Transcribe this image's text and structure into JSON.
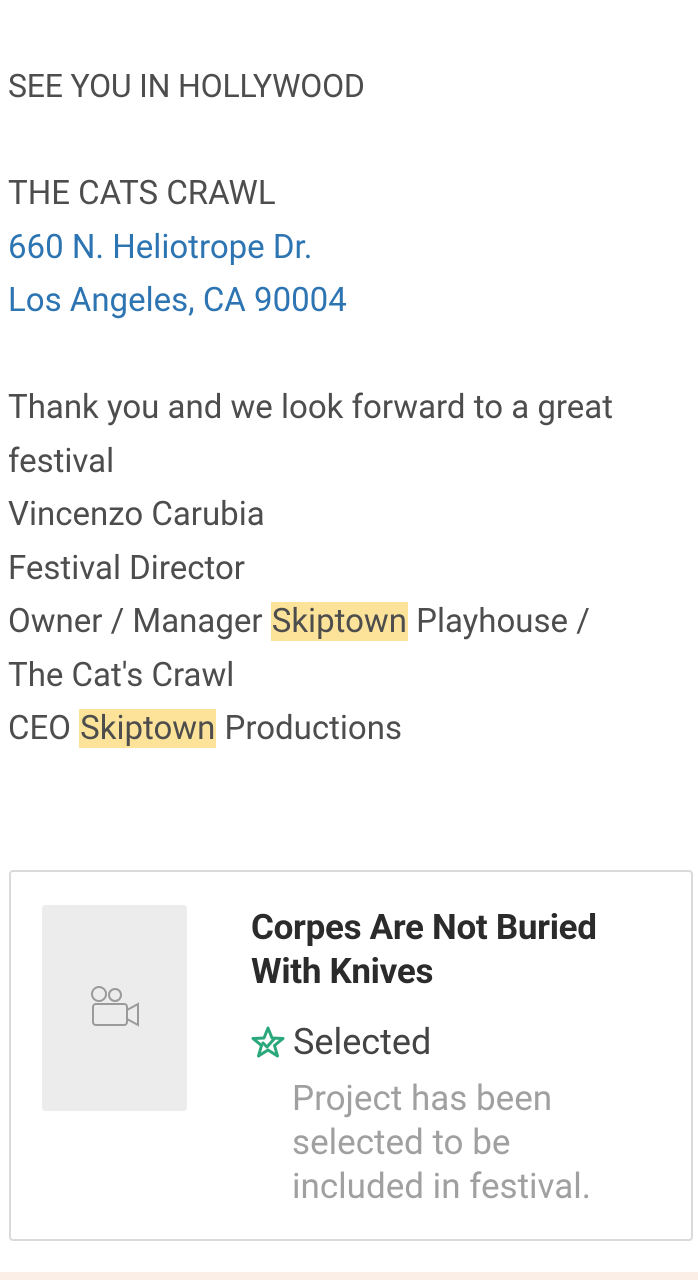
{
  "message": {
    "heading": "SEE YOU IN HOLLYWOOD",
    "venue_name": "THE CATS CRAWL",
    "address_line1": "660 N. Heliotrope Dr.",
    "address_line2": "Los Angeles, CA 90004",
    "thanks_line1": "Thank you and we look forward to a great",
    "thanks_line2": "festival",
    "signer_name": "Vincenzo Carubia",
    "signer_title": "Festival Director",
    "owner_prefix": "Owner / Manager ",
    "highlight_term": "Skiptown",
    "owner_suffix": " Playhouse /",
    "owner_line2": "The Cat's Crawl",
    "ceo_prefix": "CEO ",
    "ceo_suffix": " Productions"
  },
  "project_card": {
    "title": "Corpes Are Not Buried With Knives",
    "poster_icon": "video-camera-icon",
    "status_icon": "star-check-icon",
    "status_label": "Selected",
    "status_description": "Project has been selected to be included in festival."
  },
  "colors": {
    "link": "#2d74b2",
    "highlight": "#fde39a",
    "status_green": "#2aa87b",
    "muted_text": "#a0a0a0"
  }
}
